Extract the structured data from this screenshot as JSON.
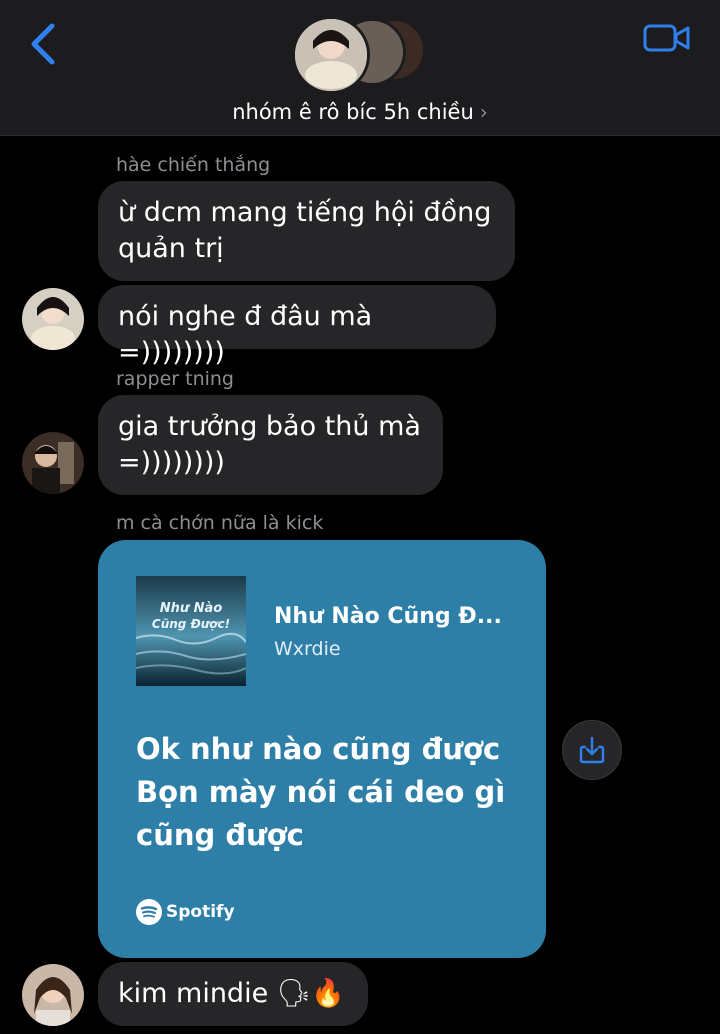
{
  "header": {
    "group_name": "nhóm ê rô bíc 5h chiều",
    "chevron": "›",
    "back_icon": "chevron-left-icon",
    "video_icon": "video-camera-icon",
    "accent": "#2f80ed"
  },
  "messages": [
    {
      "sender": "hàe chiến thắng",
      "lines": [
        "ừ dcm mang tiếng hội đồng",
        "quản trị"
      ]
    },
    {
      "lines": [
        "nói nghe đ đâu mà =))))))))"
      ]
    },
    {
      "sender": "rapper tning",
      "lines": [
        "gia trưởng bảo thủ mà",
        "=))))))))"
      ]
    },
    {
      "sender": "m cà chớn nữa là kick"
    },
    {
      "text": "kim mindie",
      "emoji": "🗣🔥"
    }
  ],
  "spotify_card": {
    "track_title": "Như Nào Cũng Đ...",
    "artist": "Wxrdie",
    "album_art_text": "Như Nào Cũng Được!",
    "lyrics": [
      "Ok như nào cũng được",
      "Bọn mày nói cái deo gì",
      "cũng được"
    ],
    "brand": "Spotify",
    "color": "#2e7fa8"
  },
  "share_icon": "share-download-icon"
}
